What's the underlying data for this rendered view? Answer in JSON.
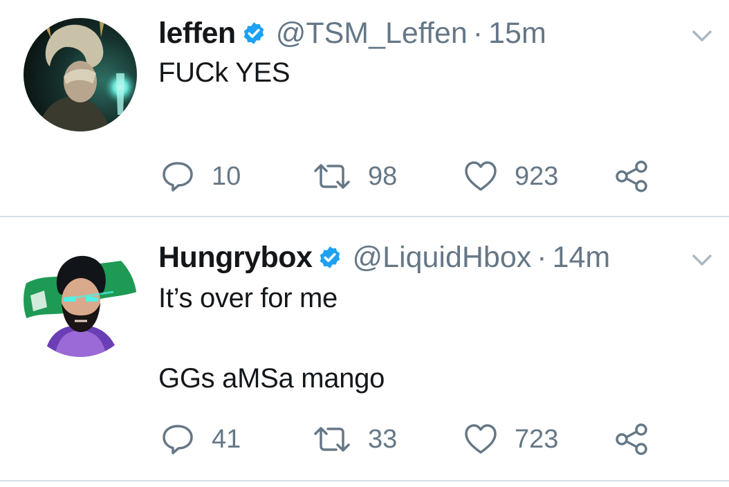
{
  "tweets": [
    {
      "name": "leffen",
      "handle": "@TSM_Leffen",
      "separator": "·",
      "time": "15m",
      "text": "FUCk YES",
      "avatar_icon": "avatar-leffen",
      "verified_icon": "verified-badge-icon",
      "replies": "10",
      "retweets": "98",
      "likes": "923"
    },
    {
      "name": "Hungrybox",
      "handle": "@LiquidHbox",
      "separator": "·",
      "time": "14m",
      "text": "It’s over for me\n\nGGs aMSa mango",
      "avatar_icon": "avatar-hungrybox",
      "verified_icon": "verified-badge-icon",
      "replies": "41",
      "retweets": "33",
      "likes": "723"
    }
  ],
  "colors": {
    "verified": "#1da1f2",
    "secondary_text": "#657786",
    "primary_text": "#14171a",
    "divider": "#d4dde5"
  }
}
